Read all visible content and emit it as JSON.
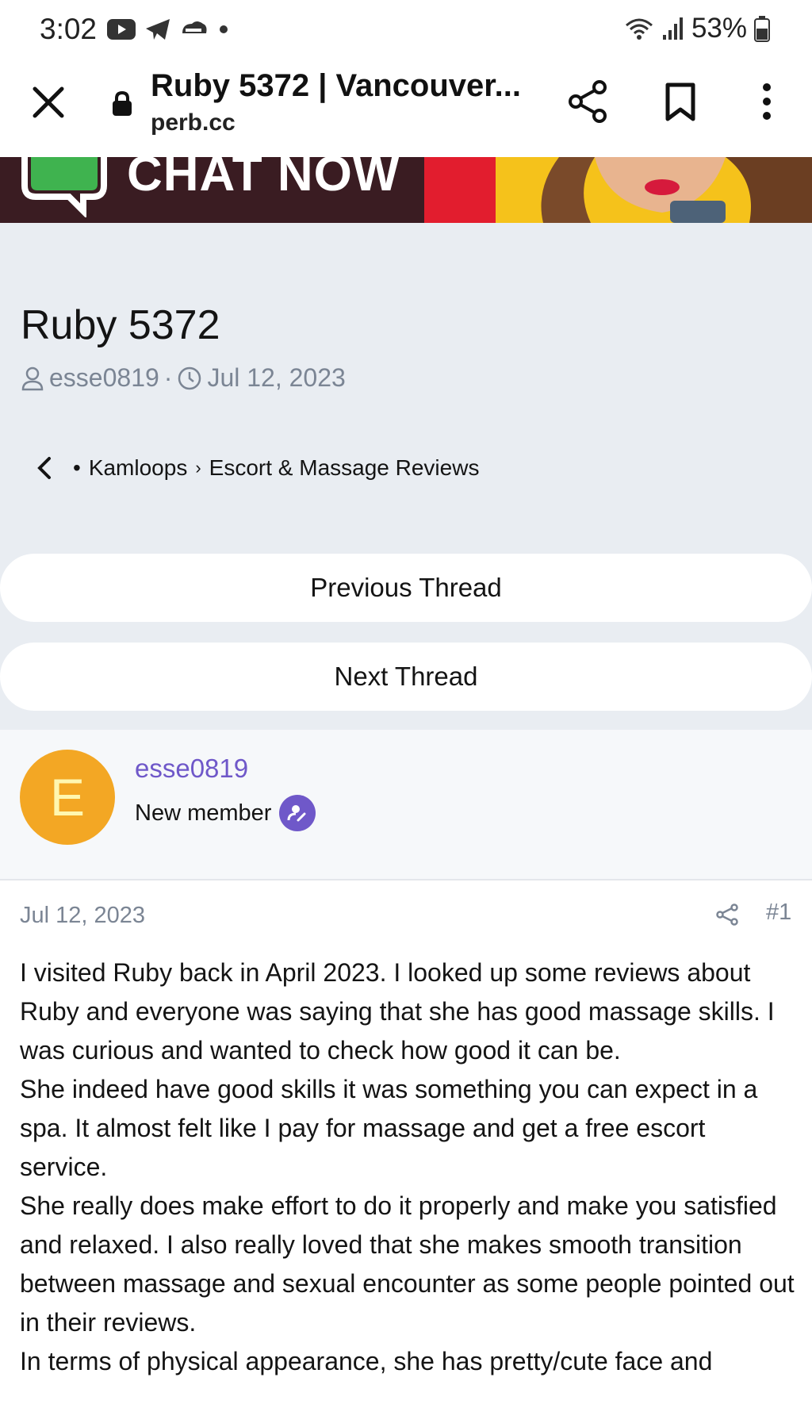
{
  "status_bar": {
    "time": "3:02",
    "battery": "53%",
    "icons": [
      "youtube-icon",
      "telegram-icon",
      "cloud-icon",
      "dot-icon",
      "wifi-icon",
      "signal-icon",
      "battery-icon"
    ]
  },
  "browser": {
    "page_title": "Ruby 5372 | Vancouver...",
    "host": "perb.cc",
    "icons": [
      "close-icon",
      "lock-icon",
      "share-icon",
      "bookmark-icon",
      "more-icon"
    ]
  },
  "banner": {
    "text": "CHAT NOW"
  },
  "thread": {
    "title": "Ruby 5372",
    "author": "esse0819",
    "separator": "·",
    "date": "Jul 12, 2023",
    "breadcrumb": {
      "bullet": "•",
      "forum": "Kamloops",
      "chevron": "›",
      "section": "Escort & Massage Reviews"
    },
    "previous_label": "Previous Thread",
    "next_label": "Next Thread"
  },
  "member": {
    "initial": "E",
    "name": "esse0819",
    "role": "New member",
    "avatar_color": "#f3a724",
    "name_color": "#6f58c9"
  },
  "post": {
    "date": "Jul 12, 2023",
    "number": "#1",
    "paragraphs": [
      "I visited Ruby back in April 2023. I looked up some reviews about Ruby and everyone was saying that she has good massage skills. I was curious and wanted to check how good it can be.",
      "She indeed have good skills it was something you can expect in a spa. It almost felt like I pay for massage and get a free escort service.",
      "She really does make effort to do it properly and make you satisfied and relaxed. I also really loved that she makes smooth transition between massage and sexual encounter as some people pointed out in their reviews.",
      "In terms of physical appearance, she has pretty/cute face and"
    ]
  }
}
